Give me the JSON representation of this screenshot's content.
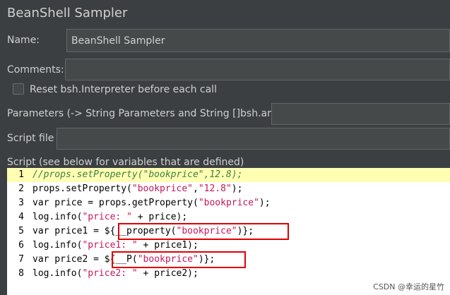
{
  "title": "BeanShell Sampler",
  "name_label": "Name:",
  "name_value": "BeanShell Sampler",
  "comments_label": "Comments:",
  "comments_value": "",
  "reset_label": "Reset bsh.Interpreter before each call",
  "parameters_label": "Parameters (-> String Parameters and String []bsh.args)",
  "parameters_value": "",
  "scriptfile_label": "Script file",
  "scriptfile_value": "",
  "script_label": "Script (see below for variables that are defined)",
  "script_lines": [
    "//props.setProperty(\"bookprice\",12.8);",
    "props.setProperty(\"bookprice\",\"12.8\");",
    "var price = props.getProperty(\"bookprice\");",
    "log.info(\"price: \" + price);",
    "var price1 = ${__property(\"bookprice\")};",
    "log.info(\"price1: \" + price1);",
    "var price2 = ${__P(\"bookprice\")};",
    "log.info(\"price2: \" + price2);"
  ],
  "line_numbers": [
    "1",
    "2",
    "3",
    "4",
    "5",
    "6",
    "7",
    "8"
  ],
  "watermark": "CSDN @幸运的星竹",
  "colors": {
    "bg": "#3c3f41",
    "highlight_line": "#ffffb4",
    "string": "#c2185b",
    "comment": "#3f7f3f",
    "red_box": "#e00000"
  }
}
